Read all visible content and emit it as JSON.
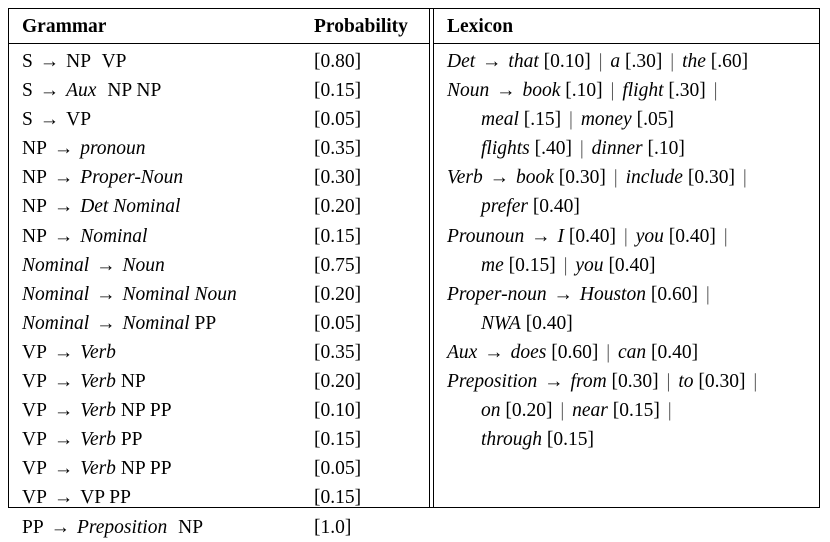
{
  "table": {
    "headers": {
      "grammar": "Grammar",
      "probability": "Probability",
      "lexicon": "Lexicon"
    },
    "grammar_rules": [
      {
        "lhs": "S",
        "rhs": [
          {
            "t": "NP",
            "i": false
          },
          {
            "t": "VP",
            "i": false
          }
        ],
        "wide_gap_after": 0,
        "prob": "[0.80]"
      },
      {
        "lhs": "S",
        "rhs": [
          {
            "t": "Aux",
            "i": true
          },
          {
            "t": "NP",
            "i": false
          },
          {
            "t": "NP",
            "i": false
          }
        ],
        "wide_gap_after": 0,
        "prob": "[0.15]"
      },
      {
        "lhs": "S",
        "rhs": [
          {
            "t": "VP",
            "i": false
          }
        ],
        "wide_gap_after": -1,
        "prob": "[0.05]"
      },
      {
        "lhs": "NP",
        "rhs": [
          {
            "t": "pronoun",
            "i": true
          }
        ],
        "wide_gap_after": -1,
        "prob": "[0.35]"
      },
      {
        "lhs": "NP",
        "rhs": [
          {
            "t": "Proper-Noun",
            "i": true
          }
        ],
        "wide_gap_after": -1,
        "prob": "[0.30]"
      },
      {
        "lhs": "NP",
        "rhs": [
          {
            "t": "Det",
            "i": true
          },
          {
            "t": "Nominal",
            "i": true
          }
        ],
        "wide_gap_after": -1,
        "prob": "[0.20]"
      },
      {
        "lhs": "NP",
        "rhs": [
          {
            "t": "Nominal",
            "i": true
          }
        ],
        "wide_gap_after": -1,
        "prob": "[0.15]"
      },
      {
        "lhs": "Nominal",
        "lhs_italic": true,
        "rhs": [
          {
            "t": "Noun",
            "i": true
          }
        ],
        "wide_gap_after": -1,
        "prob": "[0.75]"
      },
      {
        "lhs": "Nominal",
        "lhs_italic": true,
        "rhs": [
          {
            "t": "Nominal",
            "i": true
          },
          {
            "t": "Noun",
            "i": true
          }
        ],
        "wide_gap_after": -1,
        "prob": "[0.20]"
      },
      {
        "lhs": "Nominal",
        "lhs_italic": true,
        "rhs": [
          {
            "t": "Nominal",
            "i": true
          },
          {
            "t": "PP",
            "i": false
          }
        ],
        "wide_gap_after": -1,
        "prob": "[0.05]"
      },
      {
        "lhs": "VP",
        "rhs": [
          {
            "t": "Verb",
            "i": true
          }
        ],
        "wide_gap_after": -1,
        "prob": "[0.35]"
      },
      {
        "lhs": "VP",
        "rhs": [
          {
            "t": "Verb",
            "i": true
          },
          {
            "t": "NP",
            "i": false
          }
        ],
        "wide_gap_after": -1,
        "prob": "[0.20]"
      },
      {
        "lhs": "VP",
        "rhs": [
          {
            "t": "Verb",
            "i": true
          },
          {
            "t": "NP",
            "i": false
          },
          {
            "t": "PP",
            "i": false
          }
        ],
        "wide_gap_after": -1,
        "prob": "[0.10]"
      },
      {
        "lhs": "VP",
        "rhs": [
          {
            "t": "Verb",
            "i": true
          },
          {
            "t": "PP",
            "i": false
          }
        ],
        "wide_gap_after": -1,
        "prob": "[0.15]"
      },
      {
        "lhs": "VP",
        "rhs": [
          {
            "t": "Verb",
            "i": true
          },
          {
            "t": "NP",
            "i": false
          },
          {
            "t": "PP",
            "i": false
          }
        ],
        "wide_gap_after": -1,
        "prob": "[0.05]"
      },
      {
        "lhs": "VP",
        "rhs": [
          {
            "t": "VP",
            "i": false
          },
          {
            "t": "PP",
            "i": false
          }
        ],
        "wide_gap_after": -1,
        "prob": "[0.15]"
      },
      {
        "lhs": "PP",
        "rhs": [
          {
            "t": "Preposition",
            "i": true
          },
          {
            "t": "NP",
            "i": false
          }
        ],
        "wide_gap_after": 0,
        "prob": "[1.0]"
      }
    ],
    "lexicon_lines": [
      {
        "indent": false,
        "lhs": "Det",
        "parts": [
          {
            "word": "that",
            "prob": "[0.10]"
          },
          {
            "word": "a",
            "prob": "[.30]"
          },
          {
            "word": "the",
            "prob": "[.60]"
          }
        ],
        "trailing_bar": false
      },
      {
        "indent": false,
        "lhs": "Noun",
        "parts": [
          {
            "word": "book",
            "prob": "[.10]"
          },
          {
            "word": "flight",
            "prob": "[.30]"
          }
        ],
        "trailing_bar": true
      },
      {
        "indent": true,
        "lhs": null,
        "parts": [
          {
            "word": "meal",
            "prob": "[.15]"
          },
          {
            "word": "money",
            "prob": "[.05]"
          }
        ],
        "trailing_bar": false
      },
      {
        "indent": true,
        "lhs": null,
        "parts": [
          {
            "word": "flights",
            "prob": "[.40]"
          },
          {
            "word": "dinner",
            "prob": "[.10]"
          }
        ],
        "trailing_bar": false
      },
      {
        "indent": false,
        "lhs": "Verb",
        "parts": [
          {
            "word": "book",
            "prob": "[0.30]"
          },
          {
            "word": "include",
            "prob": "[0.30]"
          }
        ],
        "trailing_bar": true
      },
      {
        "indent": true,
        "lhs": null,
        "parts": [
          {
            "word": "prefer",
            "prob": "[0.40]"
          }
        ],
        "trailing_bar": false
      },
      {
        "indent": false,
        "lhs": "Prounoun",
        "parts": [
          {
            "word": "I",
            "prob": "[0.40]"
          },
          {
            "word": "you",
            "prob": "[0.40]"
          }
        ],
        "trailing_bar": true
      },
      {
        "indent": true,
        "lhs": null,
        "parts": [
          {
            "word": "me",
            "prob": "[0.15]"
          },
          {
            "word": "you",
            "prob": "[0.40]"
          }
        ],
        "trailing_bar": false
      },
      {
        "indent": false,
        "lhs": "Proper-noun",
        "parts": [
          {
            "word": "Houston",
            "prob": "[0.60]"
          }
        ],
        "trailing_bar": true
      },
      {
        "indent": true,
        "lhs": null,
        "parts": [
          {
            "word": "NWA",
            "prob": "[0.40]"
          }
        ],
        "trailing_bar": false
      },
      {
        "indent": false,
        "lhs": "Aux",
        "parts": [
          {
            "word": "does",
            "prob": "[0.60]"
          },
          {
            "word": "can",
            "prob": "[0.40]"
          }
        ],
        "trailing_bar": false
      },
      {
        "indent": false,
        "lhs": "Preposition",
        "parts": [
          {
            "word": "from",
            "prob": "[0.30]"
          },
          {
            "word": "to",
            "prob": "[0.30]"
          }
        ],
        "trailing_bar": true
      },
      {
        "indent": true,
        "lhs": null,
        "parts": [
          {
            "word": "on",
            "prob": "[0.20]"
          },
          {
            "word": "near",
            "prob": "[0.15]"
          }
        ],
        "trailing_bar": true
      },
      {
        "indent": true,
        "lhs": null,
        "parts": [
          {
            "word": "through",
            "prob": "[0.15]"
          }
        ],
        "trailing_bar": false
      }
    ],
    "symbols": {
      "arrow": "→",
      "alternation_bar": "|"
    }
  }
}
